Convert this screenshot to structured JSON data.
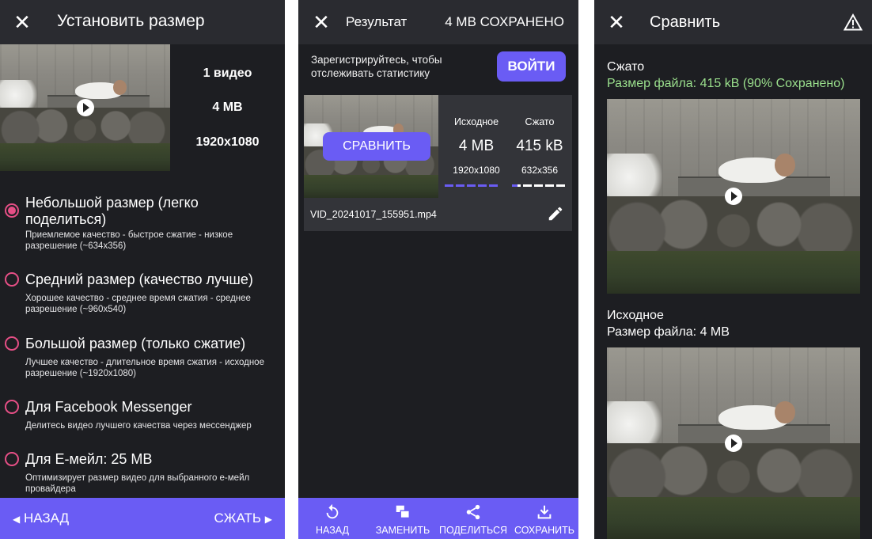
{
  "panel1": {
    "title": "Установить размер",
    "video_count": "1 видео",
    "size": "4 MB",
    "resolution": "1920x1080",
    "options": [
      {
        "title": "Небольшой размер (легко поделиться)",
        "subtitle": "Приемлемое качество - быстрое сжатие - низкое разрешение (~634x356)",
        "selected": true
      },
      {
        "title": "Средний размер (качество лучше)",
        "subtitle": "Хорошее качество - среднее время сжатия - среднее разрешение (~960x540)",
        "selected": false
      },
      {
        "title": "Большой размер (только сжатие)",
        "subtitle": "Лучшее качество - длительное время сжатия - исходное разрешение (~1920x1080)",
        "selected": false
      },
      {
        "title": "Для Facebook Messenger",
        "subtitle": "Делитесь видео лучшего качества через мессенджер",
        "selected": false
      },
      {
        "title": "Для E-мейл: 25 MB",
        "subtitle": "Оптимизирует размер видео для выбранного е-мейл провайдера",
        "selected": false
      }
    ],
    "back_label": "НАЗАД",
    "compress_label": "СЖАТЬ",
    "accent_color": "#6a5cf4",
    "radio_color": "#e64f86"
  },
  "panel2": {
    "title": "Результат",
    "saved": "4 MB СОХРАНЕНО",
    "register_text": "Зарегистрируйтесь, чтобы отслеживать статистику",
    "login_label": "ВОЙТИ",
    "compare_label": "СРАВНИТЬ",
    "original": {
      "label": "Исходное",
      "size": "4 MB",
      "resolution": "1920x1080"
    },
    "compressed": {
      "label": "Сжато",
      "size": "415 kB",
      "resolution": "632x356"
    },
    "filename": "VID_20241017_155951.mp4",
    "nav": [
      {
        "label": "НАЗАД",
        "icon": "undo-icon"
      },
      {
        "label": "ЗАМЕНИТЬ",
        "icon": "replace-icon"
      },
      {
        "label": "ПОДЕЛИТЬСЯ",
        "icon": "share-icon"
      },
      {
        "label": "СОХРАНИТЬ",
        "icon": "download-icon"
      }
    ]
  },
  "panel3": {
    "title": "Сравнить",
    "compressed_label": "Сжато",
    "compressed_size": "Размер файла: 415 kB (90% Сохранено)",
    "original_label": "Исходное",
    "original_size": "Размер файла: 4 MB",
    "saved_color": "#9be08d"
  }
}
